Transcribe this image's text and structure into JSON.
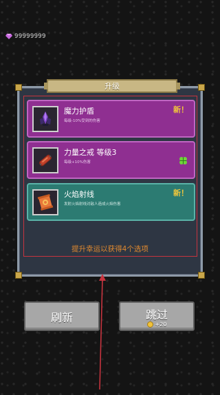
{
  "currency": {
    "icon": "gem-icon",
    "amount": "99999999",
    "color": "#c86adf"
  },
  "panel": {
    "title": "升级",
    "hint": "提升幸运以获得4个选项",
    "cards": [
      {
        "name": "魔力护盾",
        "desc": "每级-10%受到的伤害",
        "badge": "新！",
        "style": "purple",
        "icon": "armor-icon"
      },
      {
        "name": "力量之戒  等级3",
        "desc": "每级+10%伤害",
        "badge": "",
        "style": "purple",
        "icon": "ring-icon",
        "extra_icon": "clover-icon"
      },
      {
        "name": "火焰射线",
        "desc": "发射火焰射线对敌人造成火焰伤害",
        "badge": "新！",
        "style": "teal",
        "icon": "scroll-icon"
      }
    ]
  },
  "buttons": {
    "refresh_label": "刷新",
    "skip_label": "跳过",
    "skip_cost": "+20",
    "cost_icon": "coin-icon"
  },
  "colors": {
    "card_purple": "#8f2f91",
    "card_teal": "#2c7b72",
    "badge": "#f1c63b",
    "hint": "#e0892f",
    "annotation": "#c7343f"
  }
}
